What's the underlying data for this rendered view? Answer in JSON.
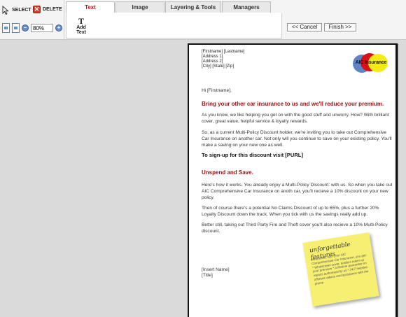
{
  "toolbar": {
    "select_label": "SELECT",
    "delete_label": "DELETE",
    "zoom_value": "80%",
    "cancel_label": "<< Cancel",
    "finish_label": "Finish >>"
  },
  "tabs": [
    {
      "label": "Text",
      "active": true
    },
    {
      "label": "Image",
      "active": false
    },
    {
      "label": "Layering & Tools",
      "active": false
    },
    {
      "label": "Managers",
      "active": false
    }
  ],
  "text_panel": {
    "add_text_label": "Add Text"
  },
  "letter": {
    "address": [
      "[Firstname] [Lastname]",
      "[Address 1]",
      "[Address 2]",
      "[City] [State] [Zip]"
    ],
    "logo_text": "AIC Insurance",
    "greeting": "Hi [Firstname],",
    "heading1": "Bring your other car insurance to us and we'll reduce your premium.",
    "para1": "As you know, we like helping you get on with the good stuff and unworry. How? With brilliant cover, great value, helpful service & loyalty rewards.",
    "para2": "So, as a current Multi-Policy Discount holder, we're inviting you to take out Comprehensive Car Insurance on another car. Not only will you continue to save on your existing policy. You'll make a saving on your new one as well.",
    "signup": "To sign-up for this discount visit [PURL]",
    "heading2": "Unspend and Save.",
    "para3": "Here's how it works. You already enjoy a Multi-Policy Discount: with us. So when you take out AIC Comprehensive Car Insurance on anoth car, you'll recieve a 10% discount on your new policy.",
    "para4": "Then of course there's a potential No Claims Discount of up to 65%, plus a further 20% Loyalty Discount down the track. When you tick with us the savings really add up.",
    "para5": "Better still, taking out Third Party Fire and Theft cover you'll also recieve a 10% Multi-Policy discount.",
    "sig_name": "[Insert Name]",
    "sig_title": "[Title]"
  },
  "sticky_note": {
    "title": "unforgettable features",
    "body": "Meanwhile, with your AIC Comprehensive Car Insurance, you get: * Windscreen cover, tenders taken up your premium * A lifetime guarantee on repairs authorised by us * 24/7 helpline, offshore advice and assistance with the phone"
  },
  "colors": {
    "accent_red": "#9b1010",
    "tab_active": "#c0111f",
    "sticky_yellow": "#f7ef72"
  }
}
